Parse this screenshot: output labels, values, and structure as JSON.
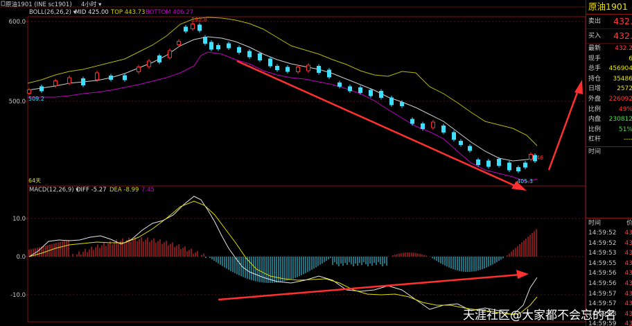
{
  "header": {
    "symbol": "原油1901 (INE sc1901)",
    "period": "4小时 ▾"
  },
  "boll": {
    "label": "BOLL(26,26,2) ▾",
    "mid": "MID 425.00",
    "top": "TOP 443.73",
    "bottom": "BOTTOM 406.27"
  },
  "price_axis": {
    "t600": "600.0",
    "t500": "500.0"
  },
  "annotations": {
    "high": "592.8",
    "start": "509.2",
    "low": "405.3",
    "last_marker": "46",
    "days": "64天"
  },
  "macd": {
    "label": "MACD(12,26,9) ▾",
    "diff": "DIFF -5.27",
    "dea": "DEA -8.99",
    "macd_val": "7.45",
    "t10": "10.0",
    "t0": "0.0",
    "tm10": "-10.0"
  },
  "colors": {
    "up": "#ff3232",
    "down": "#3fe0ff",
    "top_band": "#b9b900",
    "mid_band": "#cfcfcf",
    "bottom_band": "#c000c0",
    "arrow": "#ff3030",
    "panel_border": "#8a1010"
  },
  "panel": {
    "title": "原油1901",
    "sell_label": "卖出",
    "sell_val": "432.",
    "buy_label": "买入",
    "buy_val": "432.",
    "rows": [
      {
        "label": "最新",
        "value": "432.2",
        "color": "red"
      },
      {
        "label": "现手",
        "value": "6",
        "color": "yellow"
      },
      {
        "label": "总手",
        "value": "456904",
        "color": "yellow"
      },
      {
        "label": "持仓",
        "value": "35486",
        "color": "yellow"
      },
      {
        "label": "日增",
        "value": "2572",
        "color": "yellow"
      },
      {
        "label": "外盘",
        "value": "226092",
        "color": "red"
      },
      {
        "label": "比例",
        "value": "49%",
        "color": "red"
      },
      {
        "label": "内盘",
        "value": "230812",
        "color": "green"
      },
      {
        "label": "比例",
        "value": "51%",
        "color": "green"
      },
      {
        "label": "杠杆",
        "value": "----",
        "color": "yellow"
      }
    ],
    "time_header": "时间",
    "time_header2": "时间",
    "time_header2_right": "价",
    "ticks": [
      {
        "time": "14:59:52",
        "price": "43"
      },
      {
        "time": "14:59:52",
        "price": "43"
      },
      {
        "time": "14:59:53",
        "price": "43"
      },
      {
        "time": "14:59:55",
        "price": "43"
      },
      {
        "time": "14:59:56",
        "price": "43"
      },
      {
        "time": "14:59:56",
        "price": "43"
      },
      {
        "time": "14:59:57",
        "price": "43"
      },
      {
        "time": "14:59:57",
        "price": "43"
      },
      {
        "time": "14:59:58",
        "price": "43"
      },
      {
        "time": "14:59:59",
        "price": "43"
      }
    ]
  },
  "watermark": "天涯社区@大家都不会忘的名"
}
